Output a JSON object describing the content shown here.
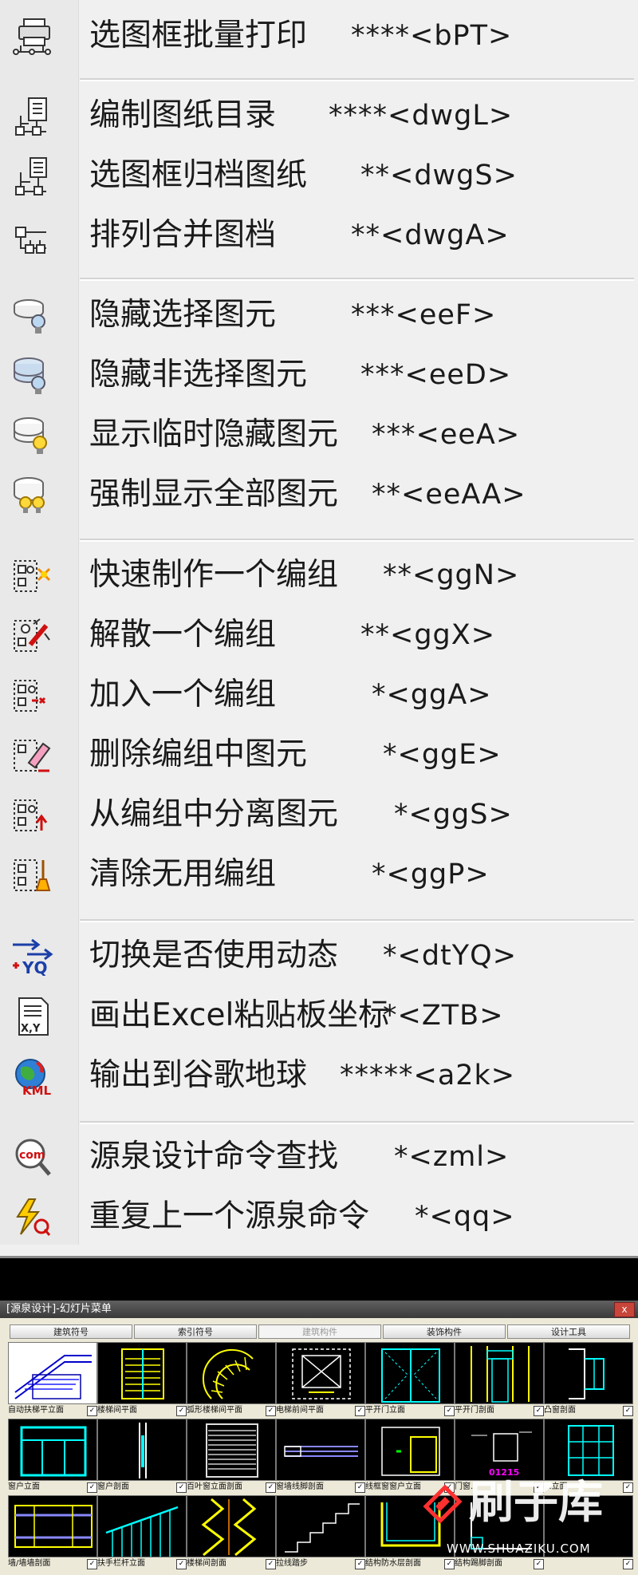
{
  "menu": {
    "items": [
      {
        "label": "选图框批量打印",
        "shortcut": "****<bPT>",
        "icon": "print-frame-icon"
      },
      {
        "label": "编制图纸目录",
        "shortcut": "****<dwgL>",
        "icon": "drawing-list-icon"
      },
      {
        "label": "选图框归档图纸",
        "shortcut": "**<dwgS>",
        "icon": "archive-drawing-icon"
      },
      {
        "label": "排列合并图档",
        "shortcut": "**<dwgA>",
        "icon": "merge-drawing-icon"
      },
      {
        "label": "隐藏选择图元",
        "shortcut": "***<eeF>",
        "icon": "hide-selected-icon"
      },
      {
        "label": "隐藏非选择图元",
        "shortcut": "***<eeD>",
        "icon": "hide-unselected-icon"
      },
      {
        "label": "显示临时隐藏图元",
        "shortcut": "***<eeA>",
        "icon": "show-hidden-icon"
      },
      {
        "label": "强制显示全部图元",
        "shortcut": "**<eeAA>",
        "icon": "show-all-icon"
      },
      {
        "label": "快速制作一个编组",
        "shortcut": "**<ggN>",
        "icon": "group-create-icon"
      },
      {
        "label": "解散一个编组",
        "shortcut": "**<ggX>",
        "icon": "group-explode-icon"
      },
      {
        "label": "加入一个编组",
        "shortcut": "*<ggA>",
        "icon": "group-add-icon"
      },
      {
        "label": "删除编组中图元",
        "shortcut": "*<ggE>",
        "icon": "group-erase-icon"
      },
      {
        "label": "从编组中分离图元",
        "shortcut": "*<ggS>",
        "icon": "group-separate-icon"
      },
      {
        "label": "清除无用编组",
        "shortcut": "*<ggP>",
        "icon": "group-purge-icon"
      },
      {
        "label": "切换是否使用动态",
        "shortcut": "*<dtYQ>",
        "icon": "dynamic-yq-icon"
      },
      {
        "label": "画出Excel粘贴板坐标",
        "shortcut": "*<ZTB>",
        "icon": "xy-clipboard-icon"
      },
      {
        "label": "输出到谷歌地球",
        "shortcut": "*****<a2k>",
        "icon": "kml-globe-icon"
      },
      {
        "label": "源泉设计命令查找",
        "shortcut": "*<zml>",
        "icon": "com-search-icon"
      },
      {
        "label": "重复上一个源泉命令",
        "shortcut": "*<qq>",
        "icon": "repeat-command-icon"
      }
    ]
  },
  "dialog": {
    "title": "[源泉设计]-幻灯片菜单",
    "close_label": "x",
    "tabs": [
      "建筑符号",
      "索引符号",
      "建筑构件",
      "装饰构件",
      "设计工具"
    ],
    "active_tab": 2,
    "rows": [
      [
        "自动扶梯平立面",
        "楼梯间平面",
        "弧形楼梯间平面",
        "电梯前间平面",
        "平开门立面",
        "平开门剖面",
        "凸窗剖面"
      ],
      [
        "窗户立面",
        "窗户剖面",
        "百叶窗立面剖面",
        "窗墙线脚剖面",
        "线框窗窗户立面",
        "门窗...",
        "...立面"
      ],
      [
        "墙/墙墙剖面",
        "扶手栏杆立面",
        "楼梯间剖面",
        "拉线踏步",
        "结构防水层剖面",
        "结构踢脚剖面",
        ""
      ]
    ],
    "thumb_label": "01215"
  },
  "watermark": {
    "text": "刷子库",
    "url": "WWW.SHUAZIKU.COM"
  },
  "colors": {
    "menu_bg": "#f0f0f0",
    "accent_yellow": "#ffff00",
    "accent_cyan": "#00ffff",
    "accent_magenta": "#ff00ff"
  }
}
